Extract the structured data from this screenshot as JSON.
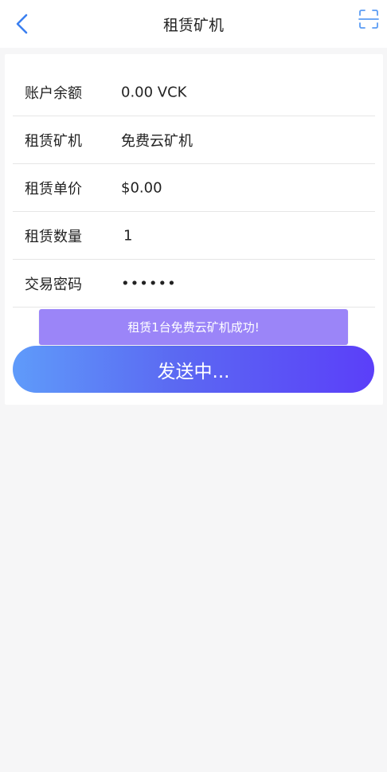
{
  "header": {
    "title": "租赁矿机",
    "back_icon": "chevron-left-icon",
    "scan_icon": "scan-icon"
  },
  "form": {
    "rows": [
      {
        "label": "账户余额",
        "value": "0.00 VCK"
      },
      {
        "label": "租赁矿机",
        "value": "免费云矿机"
      },
      {
        "label": "租赁单价",
        "value": "$0.00"
      },
      {
        "label": "租赁数量",
        "value": "1"
      },
      {
        "label": "交易密码",
        "value": "••••••"
      }
    ]
  },
  "toast": {
    "message": "租赁1台免费云矿机成功!"
  },
  "send_button": {
    "label": "发送中..."
  },
  "colors": {
    "accent": "#3b7ff0",
    "toast_bg": "#9b85f8",
    "button_start": "#5f9bfa",
    "button_end": "#5b3ff9",
    "page_bg": "#f6f6f7"
  }
}
